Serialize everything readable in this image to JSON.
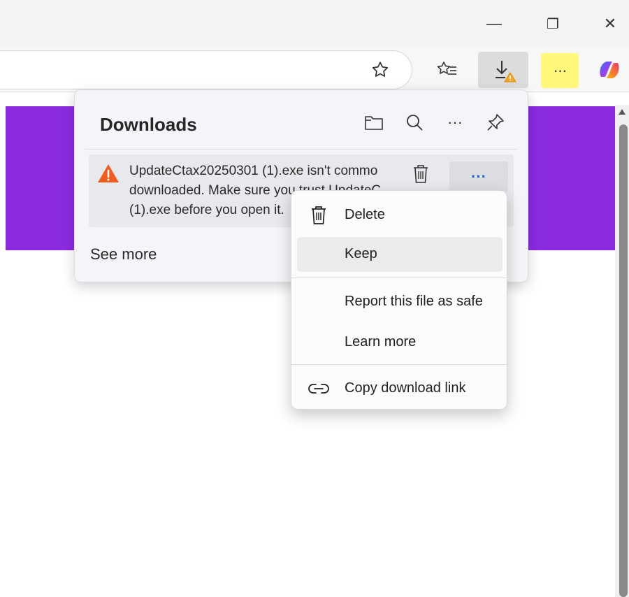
{
  "browser": {
    "window_controls": {
      "minimize_glyph": "—",
      "restore_glyph": "❐",
      "close_glyph": "✕"
    },
    "toolbar": {
      "more_glyph": "···"
    }
  },
  "downloads_panel": {
    "title": "Downloads",
    "more_glyph": "···",
    "item": {
      "warning_text_line1": "UpdateCtax20250301 (1).exe isn't commo",
      "warning_text_line2": "downloaded. Make sure you trust UpdateC",
      "warning_text_line3": "(1).exe before you open it.",
      "more_glyph": "···"
    },
    "see_more": "See more"
  },
  "context_menu": {
    "items": [
      {
        "label": "Delete",
        "icon": "trash-icon"
      },
      {
        "label": "Keep",
        "icon": ""
      },
      {
        "label": "Report this file as safe",
        "icon": ""
      },
      {
        "label": "Learn more",
        "icon": ""
      },
      {
        "label": "Copy download link",
        "icon": "link-icon"
      }
    ]
  },
  "colors": {
    "page_banner": "#8a2be2",
    "warning": "#f25c1c",
    "more_button_highlight": "#fff87a",
    "accent_blue": "#1a62d6"
  }
}
